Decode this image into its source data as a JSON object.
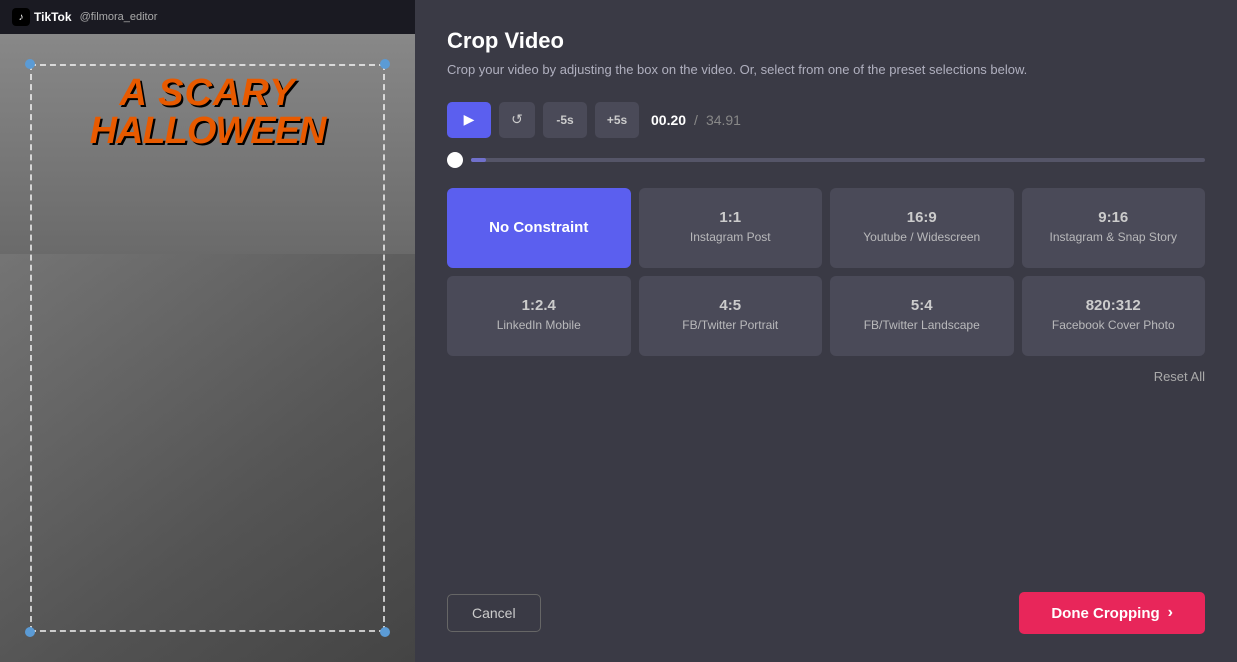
{
  "app": {
    "title": "Crop Video"
  },
  "tiktok_bar": {
    "name": "TikTok",
    "handle": "@filmora_editor",
    "icon": "♪"
  },
  "panel": {
    "title": "Crop Video",
    "subtitle": "Crop your video by adjusting the box on the video. Or, select from one of the preset selections below."
  },
  "controls": {
    "play_label": "▶",
    "reset_label": "↺",
    "minus5_label": "-5s",
    "plus5_label": "+5s",
    "current_time": "00.20",
    "separator": "/",
    "total_time": "34.91"
  },
  "presets": [
    {
      "id": "no-constraint",
      "ratio": "No Constraint",
      "label": "",
      "active": true
    },
    {
      "id": "1-1",
      "ratio": "1:1",
      "label": "Instagram Post",
      "active": false
    },
    {
      "id": "16-9",
      "ratio": "16:9",
      "label": "Youtube / Widescreen",
      "active": false
    },
    {
      "id": "9-16",
      "ratio": "9:16",
      "label": "Instagram & Snap Story",
      "active": false
    },
    {
      "id": "1-2-4",
      "ratio": "1:2.4",
      "label": "LinkedIn Mobile",
      "active": false
    },
    {
      "id": "4-5",
      "ratio": "4:5",
      "label": "FB/Twitter Portrait",
      "active": false
    },
    {
      "id": "5-4",
      "ratio": "5:4",
      "label": "FB/Twitter Landscape",
      "active": false
    },
    {
      "id": "820-312",
      "ratio": "820:312",
      "label": "Facebook Cover Photo",
      "active": false
    }
  ],
  "actions": {
    "reset_all": "Reset All",
    "cancel": "Cancel",
    "done_cropping": "Done Cropping"
  },
  "halloween": {
    "line1": "A SCARY",
    "line2": "HALLOWEEN"
  }
}
